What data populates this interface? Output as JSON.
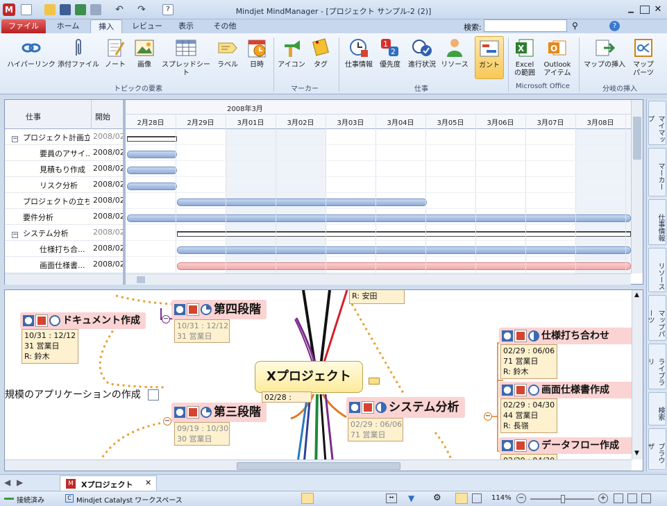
{
  "window": {
    "title": "Mindjet MindManager - [プロジェクト サンプル-2 (2)]"
  },
  "tabs": [
    "ファイル",
    "ホーム",
    "挿入",
    "レビュー",
    "表示",
    "その他"
  ],
  "search": {
    "label": "検索:"
  },
  "ribbon": {
    "buttons": [
      "ハイパーリンク",
      "添付ファイル",
      "ノート",
      "画像",
      "スプレッドシート",
      "ラベル",
      "日時",
      "アイコン",
      "タグ",
      "仕事情報",
      "優先度",
      "進行状況",
      "リソース",
      "ガント",
      "Excel",
      "の範囲",
      "Outlook",
      "アイテム",
      "マップの挿入",
      "マップ",
      "パーツ"
    ],
    "groups": [
      "トピックの要素",
      "マーカー",
      "仕事",
      "Microsoft Office",
      "分岐の挿入"
    ]
  },
  "gantt": {
    "headers": {
      "task": "仕事",
      "start": "開始"
    },
    "month": "2008年3月",
    "days": [
      "2月28日",
      "2月29日",
      "3月01日",
      "3月02日",
      "3月03日",
      "3月04日",
      "3月05日",
      "3月06日",
      "3月07日",
      "3月08日"
    ],
    "rows": [
      {
        "name": "プロジェクト計画立...",
        "start": "2008/02"
      },
      {
        "name": "要員のアサイ...",
        "start": "2008/02"
      },
      {
        "name": "見積もり作成",
        "start": "2008/02"
      },
      {
        "name": "リスク分析",
        "start": "2008/02"
      },
      {
        "name": "プロジェクトの立ち...",
        "start": "2008/02"
      },
      {
        "name": "要件分析",
        "start": "2008/02"
      },
      {
        "name": "システム分析",
        "start": "2008/02"
      },
      {
        "name": "仕様打ち合...",
        "start": "2008/02"
      },
      {
        "name": "画面仕様書...",
        "start": "2008/02"
      }
    ]
  },
  "map": {
    "center": {
      "title": "Xプロジェクト",
      "date": "02/28 :"
    },
    "top_box": "R: 安田",
    "doc": {
      "title": "ドキュメント作成",
      "l1": "10/31 : 12/12",
      "l2": "31 営業日",
      "l3": "R: 鈴木"
    },
    "phase4": {
      "title": "第四段階",
      "l1": "10/31 : 12/12",
      "l2": "31 営業日"
    },
    "app": {
      "title": "規模のアプリケーションの作成"
    },
    "phase3": {
      "title": "第三段階",
      "l1": "09/19 : 10/30",
      "l2": "30 営業日"
    },
    "sys": {
      "title": "システム分析",
      "l1": "02/29 : 06/06",
      "l2": "71 営業日"
    },
    "spec": {
      "title": "仕様打ち合わせ",
      "l1": "02/29 : 06/06",
      "l2": "71 営業日",
      "l3": "R: 鈴木"
    },
    "screen": {
      "title": "画面仕様書作成",
      "l1": "02/29 : 04/30",
      "l2": "44 営業日",
      "l3": "R: 長嶺"
    },
    "flow": {
      "title": "データフロー作成",
      "l1": "02/29 : 04/30"
    }
  },
  "sidebar": [
    "マイマップ",
    "マーカー",
    "仕事情報",
    "リソース",
    "マップパーツ",
    "ライブラリ",
    "検索",
    "ブラウザ"
  ],
  "doctab": {
    "label": "Xプロジェクト"
  },
  "status": {
    "connection": "接続済み",
    "workspace": "Mindjet Catalyst ワークスペース",
    "zoom": "114%"
  }
}
